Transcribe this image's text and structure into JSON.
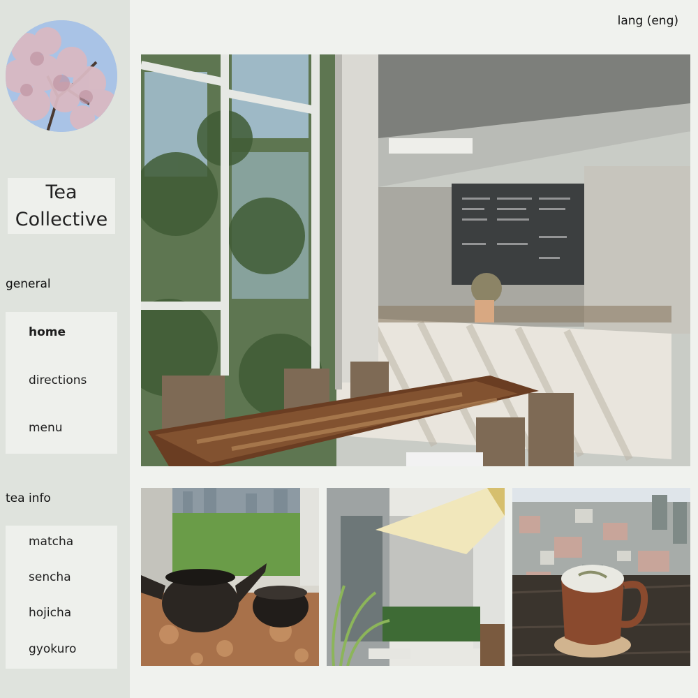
{
  "site": {
    "title": "Tea Collective",
    "language_label": "lang (eng)"
  },
  "sidebar": {
    "logo_icon": "cherry-blossom-photo",
    "general": {
      "label": "general",
      "items": [
        {
          "label": "home",
          "active": true
        },
        {
          "label": "directions",
          "active": false
        },
        {
          "label": "menu",
          "active": false
        }
      ]
    },
    "tea_info": {
      "label": "tea info",
      "items": [
        {
          "label": "matcha"
        },
        {
          "label": "sencha"
        },
        {
          "label": "hojicha"
        },
        {
          "label": "gyokuro"
        }
      ]
    }
  },
  "main": {
    "hero_photo": "tea-cafe-interior-photo",
    "gallery": [
      "teapot-view-photo",
      "terrace-garden-photo",
      "latte-cityscape-photo"
    ]
  },
  "colors": {
    "sidebar_bg": "#dfe3dd",
    "page_bg": "#f0f2ee",
    "box_bg": "#eef0ec"
  }
}
